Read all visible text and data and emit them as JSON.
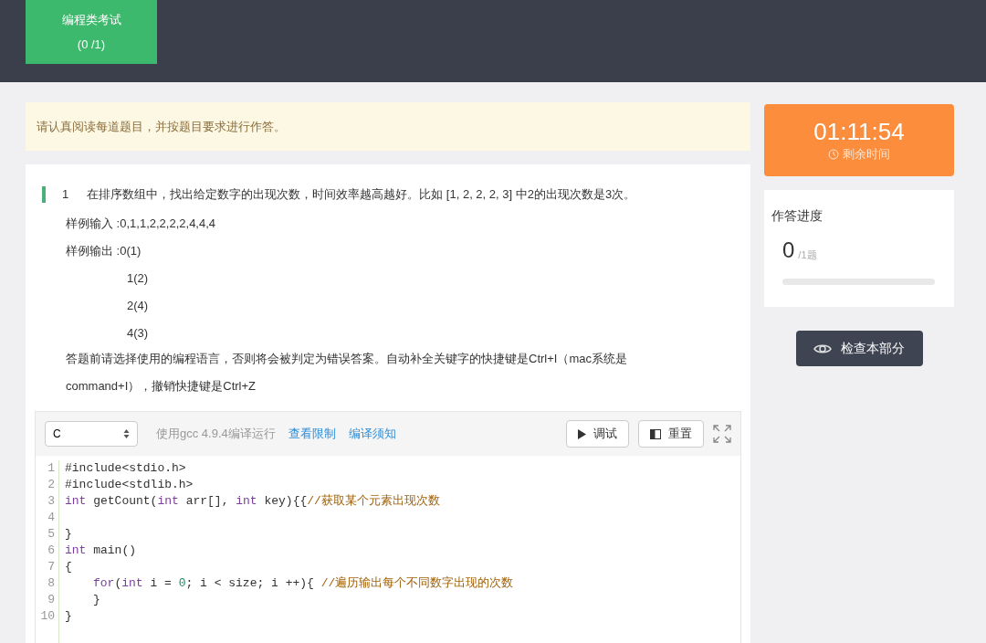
{
  "header": {
    "tabs": [
      {
        "title": "编程类考试",
        "count": "(0 /1)",
        "selected": true
      }
    ]
  },
  "notice": "请认真阅读每道题目，并按题目要求进行作答。",
  "question": {
    "number": "1",
    "text": "在排序数组中，找出给定数字的出现次数，时间效率越高越好。比如 [1, 2, 2, 2, 3] 中2的出现次数是3次。",
    "lines": [
      {
        "label": "样例输入 : ",
        "value": "0,1,1,2,2,2,2,4,4,4"
      },
      {
        "label": "样例输出 : ",
        "value": "0(1)"
      },
      {
        "value": "1(2)"
      },
      {
        "value": "2(4)"
      },
      {
        "value": "4(3)"
      }
    ],
    "note": "答题前请选择使用的编程语言，否则将会被判定为错误答案。自动补全关键字的快捷键是Ctrl+I（mac系统是command+I），撤销快捷键是Ctrl+Z"
  },
  "editor": {
    "language": "C",
    "compiler": "使用gcc 4.9.4编译运行",
    "links": [
      "查看限制",
      "编译须知"
    ],
    "buttons": [
      {
        "kind": "run",
        "label": "调试"
      },
      {
        "kind": "reset",
        "label": "重置"
      }
    ],
    "code": [
      {
        "n": "1",
        "tokens": [
          {
            "kind": "plain",
            "text": "#include<stdio.h>"
          }
        ]
      },
      {
        "n": "2",
        "tokens": [
          {
            "kind": "plain",
            "text": "#include<stdlib.h>"
          }
        ]
      },
      {
        "n": "3",
        "tokens": [
          {
            "kind": "keyword",
            "text": "int"
          },
          {
            "kind": "plain",
            "text": " getCount("
          },
          {
            "kind": "keyword",
            "text": "int"
          },
          {
            "kind": "plain",
            "text": " arr[], "
          },
          {
            "kind": "keyword",
            "text": "int"
          },
          {
            "kind": "plain",
            "text": " key){{"
          },
          {
            "kind": "comment",
            "text": "//获取某个元素出现次数"
          }
        ]
      },
      {
        "n": "4"
      },
      {
        "n": "5",
        "tokens": [
          {
            "kind": "plain",
            "text": "}"
          }
        ]
      },
      {
        "n": "6",
        "tokens": [
          {
            "kind": "keyword",
            "text": "int"
          },
          {
            "kind": "plain",
            "text": " main()"
          }
        ]
      },
      {
        "n": "7",
        "tokens": [
          {
            "kind": "plain",
            "text": "{"
          }
        ]
      },
      {
        "n": "8",
        "indent": true,
        "tokens": [
          {
            "kind": "keyword",
            "text": "for"
          },
          {
            "kind": "plain",
            "text": "("
          },
          {
            "kind": "keyword",
            "text": "int"
          },
          {
            "kind": "plain",
            "text": " i = "
          },
          {
            "kind": "number",
            "text": "0"
          },
          {
            "kind": "plain",
            "text": "; i < size; i ++){ "
          },
          {
            "kind": "comment",
            "text": "//遍历输出每个不同数字出现的次数"
          }
        ]
      },
      {
        "n": "9",
        "indent": true,
        "tokens": [
          {
            "kind": "plain",
            "text": "}"
          }
        ]
      },
      {
        "n": "10",
        "tokens": [
          {
            "kind": "plain",
            "text": "}"
          }
        ]
      }
    ]
  },
  "timer": {
    "time": "01:11:54",
    "label": "剩余时间"
  },
  "progress": {
    "title": "作答进度",
    "done": "0",
    "total": "/1题",
    "level": 0
  },
  "check_button": "检查本部分"
}
